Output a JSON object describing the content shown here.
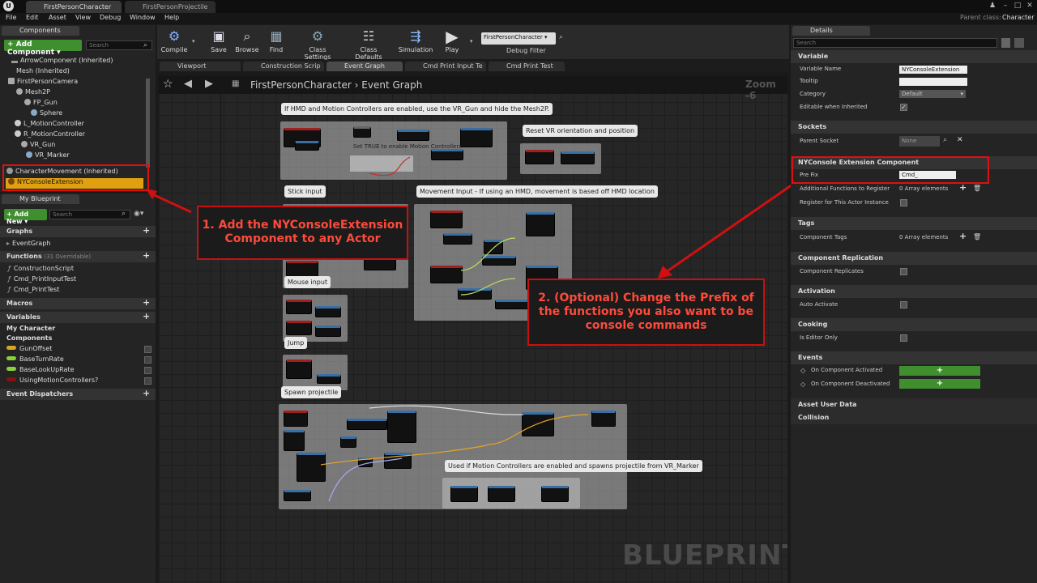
{
  "tabs": [
    "FirstPersonCharacter",
    "FirstPersonProjectile"
  ],
  "menu": [
    "File",
    "Edit",
    "Asset",
    "View",
    "Debug",
    "Window",
    "Help"
  ],
  "parent_class": {
    "label": "Parent class:",
    "value": "Character"
  },
  "components": {
    "tab": "Components",
    "add_button": "+ Add Component ▾",
    "search_placeholder": "Search",
    "tree": [
      "ArrowComponent (Inherited)",
      "Mesh (Inherited)",
      "FirstPersonCamera",
      "Mesh2P",
      "FP_Gun",
      "Sphere",
      "L_MotionController",
      "R_MotionController",
      "VR_Gun",
      "VR_Marker",
      "CharacterMovement (Inherited)",
      "NYConsoleExtension"
    ]
  },
  "my_blueprint": {
    "tab": "My Blueprint",
    "add_button": "+ Add New ▾",
    "search_placeholder": "Search",
    "graphs_label": "Graphs",
    "graphs": [
      "EventGraph"
    ],
    "functions_label": "Functions",
    "functions_note": "(31 Overridable)",
    "functions": [
      "ConstructionScript",
      "Cmd_PrintInputTest",
      "Cmd_PrintTest"
    ],
    "macros_label": "Macros",
    "variables_label": "Variables",
    "my_character": "My Character",
    "components_label": "Components",
    "variables": [
      {
        "name": "GunOffset",
        "color": "#d6a624"
      },
      {
        "name": "BaseTurnRate",
        "color": "#8ccf3c"
      },
      {
        "name": "BaseLookUpRate",
        "color": "#8ccf3c"
      },
      {
        "name": "UsingMotionControllers?",
        "color": "#8a1010"
      }
    ],
    "dispatchers_label": "Event Dispatchers"
  },
  "toolbar": {
    "buttons": [
      {
        "label": "Compile",
        "icon": "compile-icon"
      },
      {
        "label": "Save",
        "icon": "save-icon"
      },
      {
        "label": "Browse",
        "icon": "browse-icon"
      },
      {
        "label": "Find",
        "icon": "find-icon"
      },
      {
        "label": "Class Settings",
        "icon": "class-settings-icon"
      },
      {
        "label": "Class Defaults",
        "icon": "class-defaults-icon"
      },
      {
        "label": "Simulation",
        "icon": "simulation-icon"
      },
      {
        "label": "Play",
        "icon": "play-icon"
      }
    ],
    "debug_select": "FirstPersonCharacter",
    "debug_filter": "Debug Filter"
  },
  "editor_tabs": [
    "Viewport",
    "Construction Scrip",
    "Event Graph",
    "Cmd Print Input Te",
    "Cmd Print Test"
  ],
  "graph": {
    "breadcrumb_class": "FirstPersonCharacter",
    "breadcrumb_sep": "›",
    "breadcrumb_graph": "Event Graph",
    "zoom": "Zoom -6",
    "watermark": "BLUEPRINT",
    "comments": [
      "If HMD and Motion Controllers are enabled, use the VR_Gun and hide the Mesh2P.",
      "Reset VR orientation and position",
      "Stick input",
      "Movement Input - If using an HMD, movement is based off HMD location",
      "Mouse input",
      "Jump",
      "Spawn projectile",
      "Used if Motion Controllers are enabled and spawns projectile from VR_Marker"
    ],
    "inner_note": "Set TRUE to enable Motion Controllers"
  },
  "callouts": {
    "one": "1. Add the NYConsoleExtension Component to any Actor",
    "two": "2. (Optional) Change the Prefix of the functions you also want to be console commands"
  },
  "details": {
    "tab": "Details",
    "search_placeholder": "Search",
    "variable_hdr": "Variable",
    "variable_name_label": "Variable Name",
    "variable_name_value": "NYConsoleExtension",
    "tooltip_label": "Tooltip",
    "category_label": "Category",
    "category_value": "Default",
    "editable_label": "Editable when Inherited",
    "sockets_hdr": "Sockets",
    "parent_socket_label": "Parent Socket",
    "parent_socket_value": "None",
    "component_hdr": "NYConsole Extension Component",
    "prefix_label": "Pre Fix",
    "prefix_value": "Cmd_",
    "additional_label": "Additional Functions to Register",
    "additional_value": "0 Array elements",
    "register_label": "Register for This Actor Instance",
    "tags_hdr": "Tags",
    "component_tags_label": "Component Tags",
    "component_tags_value": "0 Array elements",
    "replication_hdr": "Component Replication",
    "replicates_label": "Component Replicates",
    "activation_hdr": "Activation",
    "auto_activate_label": "Auto Activate",
    "cooking_hdr": "Cooking",
    "editor_only_label": "Is Editor Only",
    "events_hdr": "Events",
    "on_activated": "On Component Activated",
    "on_deactivated": "On Component Deactivated",
    "asset_user_data_hdr": "Asset User Data",
    "collision_hdr": "Collision"
  }
}
